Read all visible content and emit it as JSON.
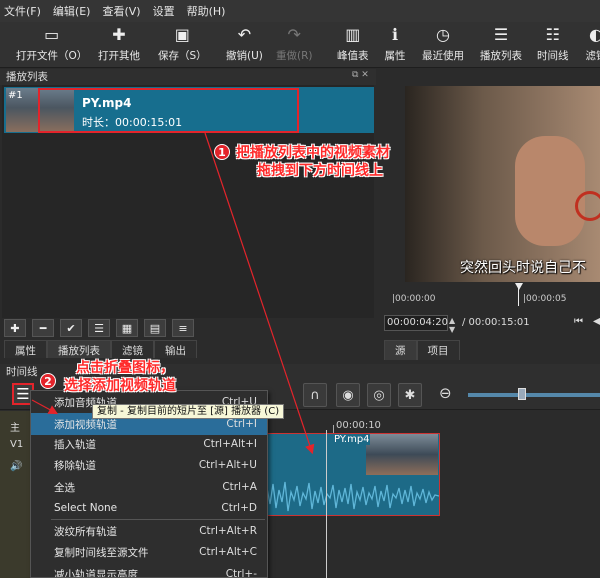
{
  "menubar": {
    "items": [
      "文件(F)",
      "编辑(E)",
      "查看(V)",
      "设置",
      "帮助(H)"
    ]
  },
  "toolbar": {
    "items": [
      {
        "label": "打开文件（O）",
        "icon": "folder-icon"
      },
      {
        "label": "打开其他",
        "icon": "open-other-icon"
      },
      {
        "label": "保存（S）",
        "icon": "save-icon"
      },
      {
        "label": "撤销(U)",
        "icon": "undo-icon"
      },
      {
        "label": "重做(R)",
        "icon": "redo-icon"
      },
      {
        "label": "峰值表",
        "icon": "peak-meter-icon"
      },
      {
        "label": "属性",
        "icon": "properties-icon"
      },
      {
        "label": "最近使用",
        "icon": "recent-icon"
      },
      {
        "label": "播放列表",
        "icon": "playlist-icon"
      },
      {
        "label": "时间线",
        "icon": "timeline-icon"
      },
      {
        "label": "滤镜",
        "icon": "filters-icon"
      }
    ]
  },
  "playlist": {
    "title": "播放列表",
    "item": {
      "index": "#1",
      "name": "PY.mp4",
      "duration": "时长：00:00:15:01"
    },
    "tabs": [
      "属性",
      "播放列表",
      "滤镜",
      "输出"
    ]
  },
  "viewer": {
    "subtitle": "突然回头时说自己不",
    "timeline_start": "|00:00:00",
    "timeline_mid": "|00:00:05",
    "current_time": "00:00:04:20",
    "total_time": "/ 00:00:15:01",
    "tabs": [
      "源",
      "项目"
    ]
  },
  "annotations": {
    "step1_num": "1",
    "step1_line1": "把播放列表中的视频素材",
    "step1_line2": "拖拽到下方时间线上",
    "step2_num": "2",
    "step2_line1": "点击折叠图标，",
    "step2_line2": "选择添加视频轨道"
  },
  "timeline": {
    "title": "时间线",
    "track_labels": [
      "主",
      "V1"
    ],
    "ruler_time": "00:00:10",
    "clip_name": "PY.mp4"
  },
  "tooltip": "复制 - 复制目前的短片至 [源] 播放器 (C)",
  "context_menu": {
    "items": [
      {
        "label": "添加音频轨道",
        "shortcut": "Ctrl+U"
      },
      {
        "label": "添加视频轨道",
        "shortcut": "Ctrl+I"
      },
      {
        "label": "插入轨道",
        "shortcut": "Ctrl+Alt+I"
      },
      {
        "label": "移除轨道",
        "shortcut": "Ctrl+Alt+U"
      },
      {
        "label": "全选",
        "shortcut": "Ctrl+A"
      },
      {
        "label": "Select None",
        "shortcut": "Ctrl+D"
      },
      {
        "label": "波纹所有轨道",
        "shortcut": "Ctrl+Alt+R"
      },
      {
        "label": "复制时间线至源文件",
        "shortcut": "Ctrl+Alt+C"
      },
      {
        "label": "减小轨道显示高度",
        "shortcut": "Ctrl+-"
      }
    ]
  },
  "colors": {
    "accent": "#176e8e",
    "annotation": "#e3242b"
  }
}
